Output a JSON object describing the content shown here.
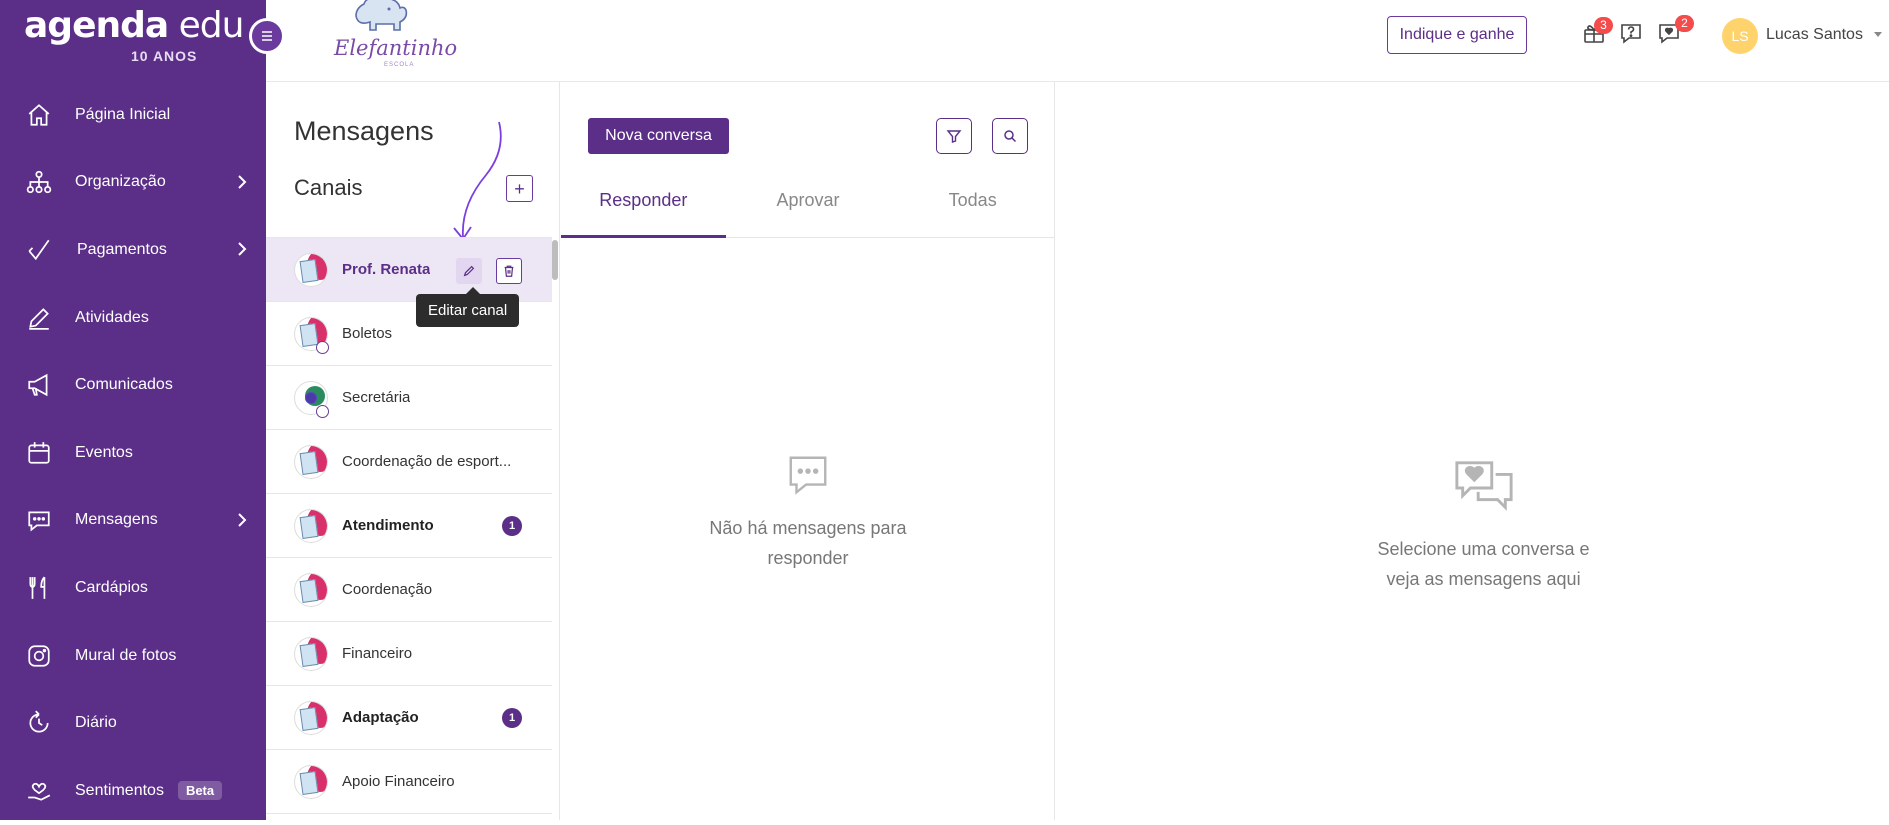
{
  "brand": {
    "name_bold": "agenda",
    "name_light": " edu",
    "years": "10 ANOS"
  },
  "school": {
    "logo_text": "Elefantinho",
    "logo_sub": "ESCOLA"
  },
  "sidebar": {
    "items": [
      {
        "label": "Página Inicial",
        "icon": "home-icon"
      },
      {
        "label": "Organização",
        "icon": "org-chart-icon",
        "expandable": true
      },
      {
        "label": "Pagamentos",
        "icon": "check-icon",
        "expandable": true
      },
      {
        "label": "Atividades",
        "icon": "pencil-icon"
      },
      {
        "label": "Comunicados",
        "icon": "megaphone-icon"
      },
      {
        "label": "Eventos",
        "icon": "calendar-icon"
      },
      {
        "label": "Mensagens",
        "icon": "chat-icon",
        "expandable": true
      },
      {
        "label": "Cardápios",
        "icon": "cutlery-icon"
      },
      {
        "label": "Mural de fotos",
        "icon": "camera-icon"
      },
      {
        "label": "Diário",
        "icon": "refresh-icon"
      },
      {
        "label": "Sentimentos",
        "icon": "hand-heart-icon",
        "badge": "Beta"
      }
    ]
  },
  "header": {
    "indique_label": "Indique e ganhe",
    "gift_count": "3",
    "chat_count": "2",
    "user_initials": "LS",
    "user_name": "Lucas Santos"
  },
  "channels": {
    "title": "Mensagens",
    "subtitle": "Canais",
    "add_label": "+",
    "tooltip": "Editar canal",
    "items": [
      {
        "name": "Prof. Renata",
        "style": "accent",
        "active": true
      },
      {
        "name": "Boletos",
        "style": "normal",
        "sub": true
      },
      {
        "name": "Secretária",
        "style": "normal",
        "sub": true,
        "avatar": "green"
      },
      {
        "name": "Coordenação de esport...",
        "style": "normal"
      },
      {
        "name": "Atendimento",
        "style": "bold",
        "count": "1"
      },
      {
        "name": "Coordenação",
        "style": "normal"
      },
      {
        "name": "Financeiro",
        "style": "normal"
      },
      {
        "name": "Adaptação",
        "style": "bold",
        "count": "1"
      },
      {
        "name": "Apoio Financeiro",
        "style": "normal"
      }
    ]
  },
  "conversations": {
    "new_label": "Nova conversa",
    "tabs": [
      "Responder",
      "Aprovar",
      "Todas"
    ],
    "active_tab": 0,
    "empty_line1": "Não há mensagens para",
    "empty_line2": "responder"
  },
  "detail": {
    "empty_line1": "Selecione uma conversa e",
    "empty_line2": "veja as mensagens aqui"
  },
  "colors": {
    "primary": "#5b2e88",
    "badge_red": "#f44b4b",
    "avatar_yellow": "#ffd36b"
  }
}
